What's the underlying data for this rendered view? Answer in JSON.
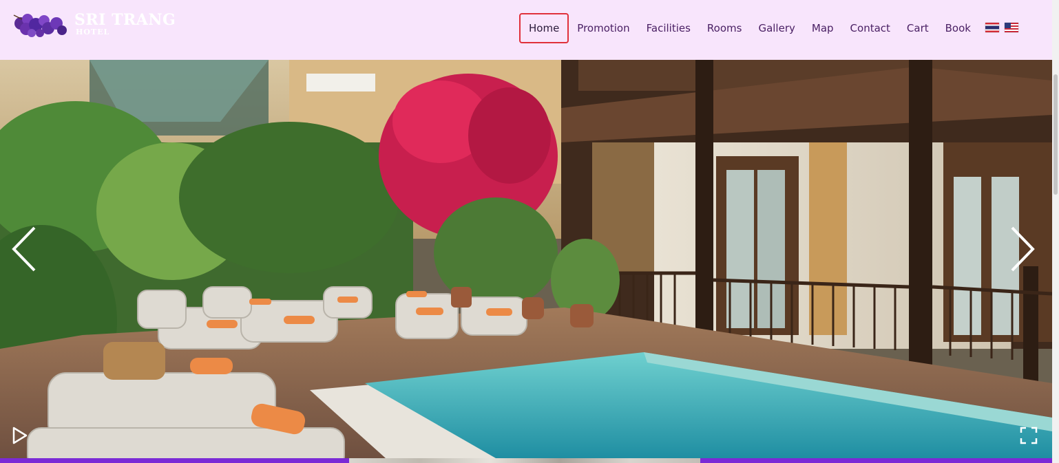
{
  "logo": {
    "name": "SRI TRANG",
    "sub": "HOTEL"
  },
  "nav": {
    "items": [
      {
        "label": "Home",
        "active": true
      },
      {
        "label": "Promotion"
      },
      {
        "label": "Facilities"
      },
      {
        "label": "Rooms"
      },
      {
        "label": "Gallery"
      },
      {
        "label": "Map"
      },
      {
        "label": "Contact"
      },
      {
        "label": "Cart"
      },
      {
        "label": "Book"
      }
    ]
  },
  "languages": [
    {
      "icon": "thai-flag-icon"
    },
    {
      "icon": "us-flag-icon"
    }
  ],
  "slider": {
    "prev_icon": "chevron-left-icon",
    "next_icon": "chevron-right-icon",
    "play_icon": "play-icon",
    "fullscreen_icon": "fullscreen-icon"
  },
  "colors": {
    "header_bg": "#f8e5fc",
    "nav_text": "#4a2064",
    "active_border": "#e0303a",
    "progress_bar": "#7b2ad6"
  }
}
